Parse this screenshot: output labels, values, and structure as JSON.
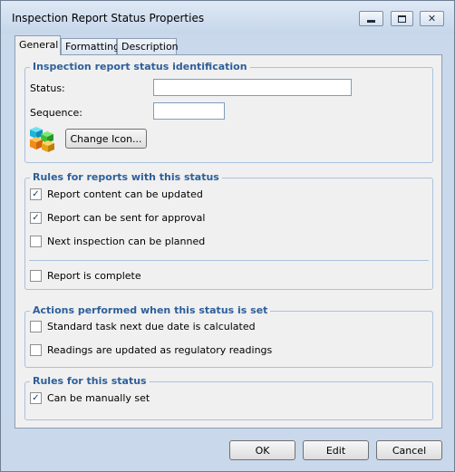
{
  "window": {
    "title": "Inspection Report Status Properties"
  },
  "tabs": [
    {
      "label": "General",
      "selected": true
    },
    {
      "label": "Formatting",
      "selected": false
    },
    {
      "label": "Description",
      "selected": false
    }
  ],
  "identification": {
    "legend": "Inspection report status identification",
    "status_label": "Status:",
    "status_value": "",
    "sequence_label": "Sequence:",
    "sequence_value": "",
    "change_icon_label": "Change Icon...",
    "icon": "colored-cubes-icon"
  },
  "rules_reports": {
    "legend": "Rules for reports with this status",
    "items": [
      {
        "label": "Report content can be updated",
        "checked": true
      },
      {
        "label": "Report can be sent for approval",
        "checked": true
      },
      {
        "label": "Next inspection can be planned",
        "checked": false
      },
      {
        "label": "Report is complete",
        "checked": false
      }
    ]
  },
  "actions": {
    "legend": "Actions performed when this status is set",
    "items": [
      {
        "label": "Standard task next due date is calculated",
        "checked": false
      },
      {
        "label": "Readings are updated as regulatory readings",
        "checked": false
      }
    ]
  },
  "rules_status": {
    "legend": "Rules for this status",
    "items": [
      {
        "label": "Can be manually set",
        "checked": true
      }
    ]
  },
  "footer": {
    "ok_label": "OK",
    "edit_label": "Edit",
    "cancel_label": "Cancel"
  },
  "colors": {
    "window_frame": "#c9d8ea",
    "panel": "#f0f0f0",
    "legend_text": "#2e5f9a",
    "group_border": "#a9c2dd"
  }
}
